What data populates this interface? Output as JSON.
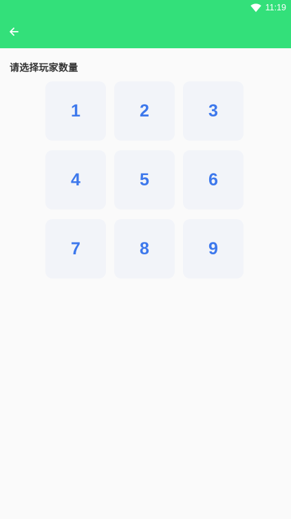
{
  "status_bar": {
    "time": "11:19",
    "wifi_icon": "wifi-icon"
  },
  "app_bar": {
    "color": "#33e07a",
    "back_icon": "arrow-left-icon"
  },
  "prompt": "请选择玩家数量",
  "options": [
    "1",
    "2",
    "3",
    "4",
    "5",
    "6",
    "7",
    "8",
    "9"
  ],
  "accent_color": "#3d78ec"
}
